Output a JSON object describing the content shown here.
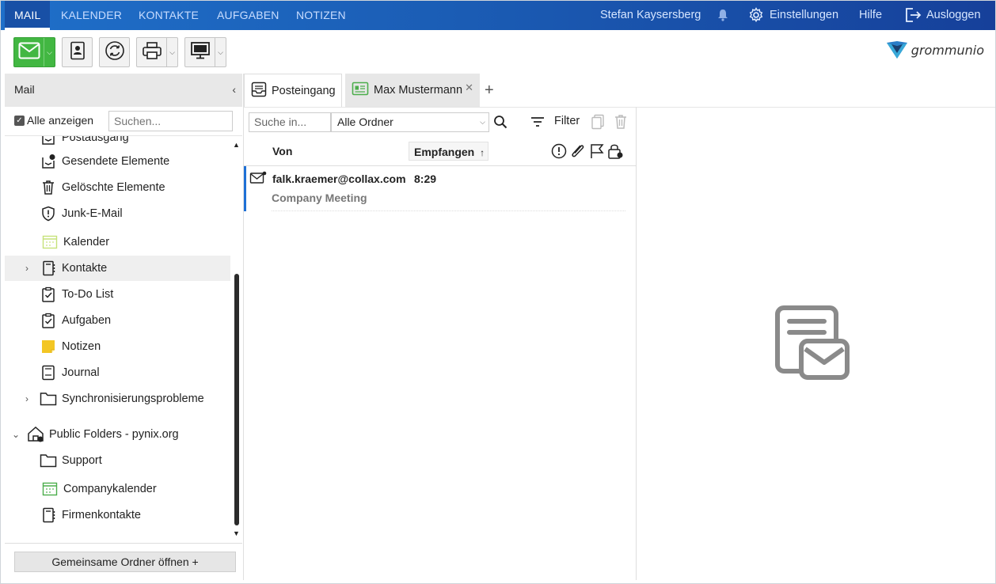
{
  "topnav": {
    "items": [
      "MAIL",
      "KALENDER",
      "KONTAKTE",
      "AUFGABEN",
      "NOTIZEN"
    ],
    "active": "MAIL",
    "user": "Stefan Kaysersberg",
    "settings": "Einstellungen",
    "help": "Hilfe",
    "logout": "Ausloggen"
  },
  "toolbar": {
    "buttons": [
      "mail-new",
      "contact",
      "refresh",
      "print",
      "view"
    ],
    "logo_text": "grommunio",
    "accent": "#42b742"
  },
  "sidebar": {
    "header": "Mail",
    "show_all_label": "Alle anzeigen",
    "show_all_checked": true,
    "search_placeholder": "Suchen...",
    "items": [
      {
        "label": "Postausgang",
        "icon": "outbox-icon"
      },
      {
        "label": "Gesendete Elemente",
        "icon": "sent-icon"
      },
      {
        "label": "Gelöschte Elemente",
        "icon": "trash-icon"
      },
      {
        "label": "Junk-E-Mail",
        "icon": "shield-icon"
      },
      {
        "label": "Kalender",
        "icon": "calendar-icon"
      },
      {
        "label": "Kontakte",
        "icon": "contacts-icon"
      },
      {
        "label": "To-Do List",
        "icon": "todo-icon"
      },
      {
        "label": "Aufgaben",
        "icon": "tasks-icon"
      },
      {
        "label": "Notizen",
        "icon": "notes-icon"
      },
      {
        "label": "Journal",
        "icon": "journal-icon"
      },
      {
        "label": "Synchronisierungsprobleme",
        "icon": "folder-icon"
      },
      {
        "label": "Public Folders - pynix.org",
        "icon": "public-folder-icon"
      },
      {
        "label": "Support",
        "icon": "folder-icon"
      },
      {
        "label": "Companykalender",
        "icon": "calendar-icon"
      },
      {
        "label": "Firmenkontakte",
        "icon": "contacts-icon"
      }
    ],
    "open_shared_button": "Gemeinsame Ordner öffnen +"
  },
  "tabs": [
    {
      "label": "Posteingang",
      "icon": "inbox-icon"
    },
    {
      "label": "Max Mustermann",
      "icon": "contact-card-icon"
    }
  ],
  "search": {
    "placeholder": "Suche in...",
    "folder_scope": "Alle Ordner",
    "filter_label": "Filter"
  },
  "columns": {
    "from": "Von",
    "received": "Empfangen"
  },
  "messages": [
    {
      "from": "falk.kraemer@collax.com",
      "time": "8:29",
      "subject": "Company Meeting",
      "unread": true
    }
  ]
}
